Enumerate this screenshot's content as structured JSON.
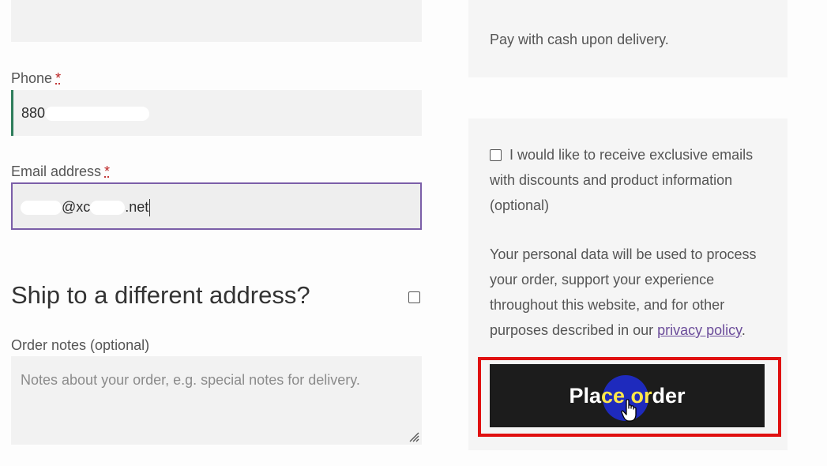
{
  "billing": {
    "phone_label": "Phone",
    "phone_required": "*",
    "phone_value": "880",
    "email_label": "Email address",
    "email_required": "*",
    "email_value_mid": "@xc",
    "email_value_end": ".net"
  },
  "shipping": {
    "title": "Ship to a different address?",
    "checked": false
  },
  "order_notes": {
    "label": "Order notes (optional)",
    "placeholder": "Notes about your order, e.g. special notes for delivery."
  },
  "payment": {
    "description": "Pay with cash upon delivery."
  },
  "optin": {
    "text": "I would like to receive exclusive emails with discounts and product information (optional)",
    "checked": false
  },
  "privacy": {
    "text_before": "Your personal data will be used to process your order, support your experience throughout this website, and for other purposes described in our ",
    "link_text": "privacy policy",
    "text_after": "."
  },
  "place_order": {
    "label_part1": "Pla",
    "label_part2": "ce or",
    "label_part3": "der"
  },
  "colors": {
    "highlight": "#e01010",
    "click_indicator": "#1f2ccf",
    "button": "#1c1c1c"
  }
}
